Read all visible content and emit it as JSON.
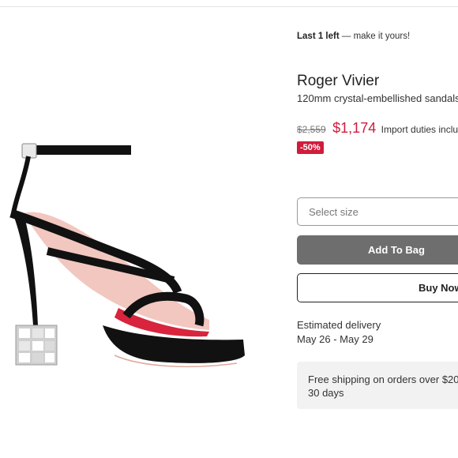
{
  "stock": {
    "bold": "Last 1 left",
    "rest": "— make it yours!"
  },
  "product": {
    "brand": "Roger Vivier",
    "name": "120mm crystal-embellished sandals",
    "old_price": "$2,559",
    "new_price": "$1,174",
    "duties": "Import duties included",
    "discount": "-50%"
  },
  "actions": {
    "size_placeholder": "Select size",
    "add_to_bag": "Add To Bag",
    "buy_now": "Buy Now"
  },
  "delivery": {
    "label": "Estimated delivery",
    "dates": "May 26 - May 29"
  },
  "shipping": {
    "line1": "Free shipping on orders over $20",
    "line2": "30 days"
  },
  "colors": {
    "price_red": "#d01c3c",
    "add_bag_gray": "#6e6e6e",
    "panel_gray": "#f2f2f2"
  }
}
